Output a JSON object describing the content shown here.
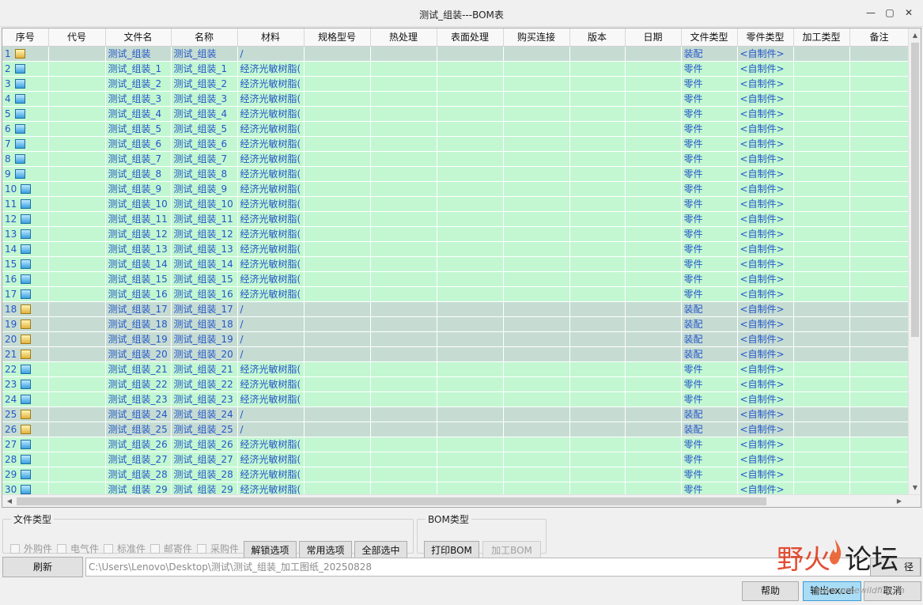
{
  "window": {
    "title": "测试_组装---BOM表",
    "controls": [
      "—",
      "▢",
      "✕"
    ]
  },
  "columns": [
    "序号",
    "代号",
    "文件名",
    "名称",
    "材料",
    "规格型号",
    "热处理",
    "表面处理",
    "购买连接",
    "版本",
    "日期",
    "文件类型",
    "零件类型",
    "加工类型",
    "备注"
  ],
  "rows": [
    {
      "idx": "1",
      "kind": "asm",
      "file": "测试_组装",
      "name": "测试_组装",
      "material": "/",
      "ftype": "装配",
      "ptype": "<自制件>"
    },
    {
      "idx": "2",
      "kind": "part",
      "file": "测试_组装_1",
      "name": "测试_组装_1",
      "material": "经济光敏树脂(",
      "ftype": "零件",
      "ptype": "<自制件>"
    },
    {
      "idx": "3",
      "kind": "part",
      "file": "测试_组装_2",
      "name": "测试_组装_2",
      "material": "经济光敏树脂(",
      "ftype": "零件",
      "ptype": "<自制件>"
    },
    {
      "idx": "4",
      "kind": "part",
      "file": "测试_组装_3",
      "name": "测试_组装_3",
      "material": "经济光敏树脂(",
      "ftype": "零件",
      "ptype": "<自制件>"
    },
    {
      "idx": "5",
      "kind": "part",
      "file": "测试_组装_4",
      "name": "测试_组装_4",
      "material": "经济光敏树脂(",
      "ftype": "零件",
      "ptype": "<自制件>"
    },
    {
      "idx": "6",
      "kind": "part",
      "file": "测试_组装_5",
      "name": "测试_组装_5",
      "material": "经济光敏树脂(",
      "ftype": "零件",
      "ptype": "<自制件>"
    },
    {
      "idx": "7",
      "kind": "part",
      "file": "测试_组装_6",
      "name": "测试_组装_6",
      "material": "经济光敏树脂(",
      "ftype": "零件",
      "ptype": "<自制件>"
    },
    {
      "idx": "8",
      "kind": "part",
      "file": "测试_组装_7",
      "name": "测试_组装_7",
      "material": "经济光敏树脂(",
      "ftype": "零件",
      "ptype": "<自制件>"
    },
    {
      "idx": "9",
      "kind": "part",
      "file": "测试_组装_8",
      "name": "测试_组装_8",
      "material": "经济光敏树脂(",
      "ftype": "零件",
      "ptype": "<自制件>"
    },
    {
      "idx": "10",
      "kind": "part",
      "file": "测试_组装_9",
      "name": "测试_组装_9",
      "material": "经济光敏树脂(",
      "ftype": "零件",
      "ptype": "<自制件>"
    },
    {
      "idx": "11",
      "kind": "part",
      "file": "测试_组装_10",
      "name": "测试_组装_10",
      "material": "经济光敏树脂(",
      "ftype": "零件",
      "ptype": "<自制件>"
    },
    {
      "idx": "12",
      "kind": "part",
      "file": "测试_组装_11",
      "name": "测试_组装_11",
      "material": "经济光敏树脂(",
      "ftype": "零件",
      "ptype": "<自制件>"
    },
    {
      "idx": "13",
      "kind": "part",
      "file": "测试_组装_12",
      "name": "测试_组装_12",
      "material": "经济光敏树脂(",
      "ftype": "零件",
      "ptype": "<自制件>"
    },
    {
      "idx": "14",
      "kind": "part",
      "file": "测试_组装_13",
      "name": "测试_组装_13",
      "material": "经济光敏树脂(",
      "ftype": "零件",
      "ptype": "<自制件>"
    },
    {
      "idx": "15",
      "kind": "part",
      "file": "测试_组装_14",
      "name": "测试_组装_14",
      "material": "经济光敏树脂(",
      "ftype": "零件",
      "ptype": "<自制件>"
    },
    {
      "idx": "16",
      "kind": "part",
      "file": "测试_组装_15",
      "name": "测试_组装_15",
      "material": "经济光敏树脂(",
      "ftype": "零件",
      "ptype": "<自制件>"
    },
    {
      "idx": "17",
      "kind": "part",
      "file": "测试_组装_16",
      "name": "测试_组装_16",
      "material": "经济光敏树脂(",
      "ftype": "零件",
      "ptype": "<自制件>"
    },
    {
      "idx": "18",
      "kind": "asm",
      "file": "测试_组装_17",
      "name": "测试_组装_17",
      "material": "/",
      "ftype": "装配",
      "ptype": "<自制件>"
    },
    {
      "idx": "19",
      "kind": "asm",
      "file": "测试_组装_18",
      "name": "测试_组装_18",
      "material": "/",
      "ftype": "装配",
      "ptype": "<自制件>"
    },
    {
      "idx": "20",
      "kind": "asm",
      "file": "测试_组装_19",
      "name": "测试_组装_19",
      "material": "/",
      "ftype": "装配",
      "ptype": "<自制件>"
    },
    {
      "idx": "21",
      "kind": "asm",
      "file": "测试_组装_20",
      "name": "测试_组装_20",
      "material": "/",
      "ftype": "装配",
      "ptype": "<自制件>"
    },
    {
      "idx": "22",
      "kind": "part",
      "file": "测试_组装_21",
      "name": "测试_组装_21",
      "material": "经济光敏树脂(",
      "ftype": "零件",
      "ptype": "<自制件>"
    },
    {
      "idx": "23",
      "kind": "part",
      "file": "测试_组装_22",
      "name": "测试_组装_22",
      "material": "经济光敏树脂(",
      "ftype": "零件",
      "ptype": "<自制件>"
    },
    {
      "idx": "24",
      "kind": "part",
      "file": "测试_组装_23",
      "name": "测试_组装_23",
      "material": "经济光敏树脂(",
      "ftype": "零件",
      "ptype": "<自制件>"
    },
    {
      "idx": "25",
      "kind": "asm",
      "file": "测试_组装_24",
      "name": "测试_组装_24",
      "material": "/",
      "ftype": "装配",
      "ptype": "<自制件>"
    },
    {
      "idx": "26",
      "kind": "asm",
      "file": "测试_组装_25",
      "name": "测试_组装_25",
      "material": "/",
      "ftype": "装配",
      "ptype": "<自制件>"
    },
    {
      "idx": "27",
      "kind": "part",
      "file": "测试_组装_26",
      "name": "测试_组装_26",
      "material": "经济光敏树脂(",
      "ftype": "零件",
      "ptype": "<自制件>"
    },
    {
      "idx": "28",
      "kind": "part",
      "file": "测试_组装_27",
      "name": "测试_组装_27",
      "material": "经济光敏树脂(",
      "ftype": "零件",
      "ptype": "<自制件>"
    },
    {
      "idx": "29",
      "kind": "part",
      "file": "测试_组装_28",
      "name": "测试_组装_28",
      "material": "经济光敏树脂(",
      "ftype": "零件",
      "ptype": "<自制件>"
    },
    {
      "idx": "30",
      "kind": "part",
      "file": "测试_组装_29",
      "name": "测试_组装_29",
      "material": "经济光敏树脂(",
      "ftype": "零件",
      "ptype": "<自制件>"
    }
  ],
  "file_type_group": {
    "legend": "文件类型",
    "checkboxes": [
      "外购件",
      "电气件",
      "标准件",
      "邮寄件",
      "采购件"
    ],
    "buttons": {
      "unlock": "解锁选项",
      "common": "常用选项",
      "select_all": "全部选中"
    }
  },
  "bom_type_group": {
    "legend": "BOM类型",
    "buttons": {
      "print": "打印BOM",
      "process": "加工BOM"
    }
  },
  "refresh_label": "刷新",
  "path": "C:\\Users\\Lenovo\\Desktop\\测试\\测试_组装_加工图纸_20250828",
  "path_button_label": "径",
  "footer": {
    "help": "帮助",
    "export": "输出excel",
    "cancel": "取消"
  },
  "watermark": {
    "part1": "野火",
    "part2": "论坛",
    "url": "www.proewildfire.cn"
  },
  "colors": {
    "part_row": "#c2f7d2",
    "asm_row": "#c6dcd3",
    "cell_text": "#2456c8"
  }
}
